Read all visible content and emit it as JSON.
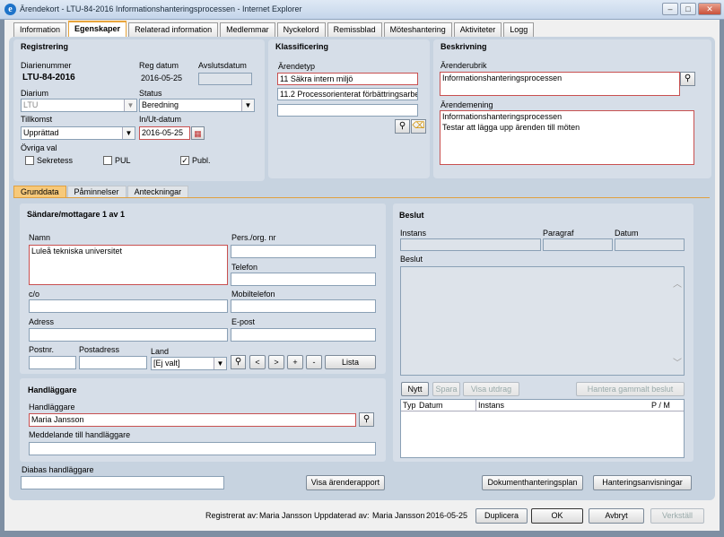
{
  "window": {
    "title": "Ärendekort - LTU-84-2016 Informationshanteringsprocessen - Internet Explorer",
    "min": "‒",
    "max": "□",
    "close": "✕"
  },
  "tabs": [
    "Information",
    "Egenskaper",
    "Relaterad information",
    "Medlemmar",
    "Nyckelord",
    "Remissblad",
    "Möteshantering",
    "Aktiviteter",
    "Logg"
  ],
  "registrering": {
    "header": "Registrering",
    "dianr_label": "Diarienummer",
    "dianr": "LTU-84-2016",
    "regdatum_label": "Reg datum",
    "regdatum": "2016-05-25",
    "avslut_label": "Avslutsdatum",
    "avslut": "",
    "diarium_label": "Diarium",
    "diarium": "LTU",
    "status_label": "Status",
    "status": "Beredning",
    "tillkomst_label": "Tillkomst",
    "tillkomst": "Upprättad",
    "inut_label": "In/Ut-datum",
    "inut": "2016-05-25",
    "ovriga_label": "Övriga val",
    "sekretess": "Sekretess",
    "pul": "PUL",
    "publ": "Publ.",
    "check": "✓"
  },
  "klassificering": {
    "header": "Klassificering",
    "arendetyp_label": "Ärendetyp",
    "typ1": "11 Säkra intern miljö",
    "typ2": "11.2 Processorienterat förbättringsarbete",
    "typ3": ""
  },
  "beskrivning": {
    "header": "Beskrivning",
    "rubrik_label": "Ärenderubrik",
    "rubrik": "Informationshanteringsprocessen",
    "mening_label": "Ärendemening",
    "mening1": "Informationshanteringsprocessen",
    "mening2": "Testar att lägga upp ärenden till möten"
  },
  "subtabs": [
    "Grunddata",
    "Påminnelser",
    "Anteckningar"
  ],
  "sandare": {
    "header": "Sändare/mottagare 1 av 1",
    "namn_label": "Namn",
    "namn": "Luleå tekniska universitet",
    "pers_label": "Pers./org. nr",
    "pers": "",
    "telefon_label": "Telefon",
    "telefon": "",
    "co_label": "c/o",
    "co": "",
    "mobil_label": "Mobiltelefon",
    "mobil": "",
    "adress_label": "Adress",
    "adress": "",
    "epost_label": "E-post",
    "epost": "",
    "postnr_label": "Postnr.",
    "postnr": "",
    "postadress_label": "Postadress",
    "postadress": "",
    "land_label": "Land",
    "land": "[Ej valt]",
    "lt": "<",
    "gt": ">",
    "plus": "+",
    "minus": "-",
    "lista": "Lista"
  },
  "handlaggare": {
    "header": "Handläggare",
    "label": "Handläggare",
    "value": "Maria Jansson",
    "medd_label": "Meddelande till handläggare",
    "medd": ""
  },
  "beslut": {
    "header": "Beslut",
    "instans_label": "Instans",
    "paragraf_label": "Paragraf",
    "datum_label": "Datum",
    "beslut_label": "Beslut",
    "nytt": "Nytt",
    "spara": "Spara",
    "visa": "Visa utdrag",
    "hantera": "Hantera gammalt beslut",
    "col_typ": "Typ",
    "col_datum": "Datum",
    "col_instans": "Instans",
    "col_pm": "P / M"
  },
  "diabas": {
    "label": "Diabas handläggare",
    "value": ""
  },
  "buttons": {
    "visa_rapport": "Visa ärenderapport",
    "dokplan": "Dokumenthanteringsplan",
    "hanteringsanv": "Hanteringsanvisningar",
    "duplicera": "Duplicera",
    "ok": "OK",
    "avbryt": "Avbryt",
    "verkstall": "Verkställ"
  },
  "status": {
    "reg_label": "Registrerat av:",
    "reg_by": "Maria Jansson",
    "upd_label": "Uppdaterad av:",
    "upd_by": "Maria Jansson",
    "date": "2016-05-25"
  },
  "icons": {
    "search": "magnifier-icon",
    "calendar": "calendar-icon",
    "eraser": "eraser-icon"
  }
}
